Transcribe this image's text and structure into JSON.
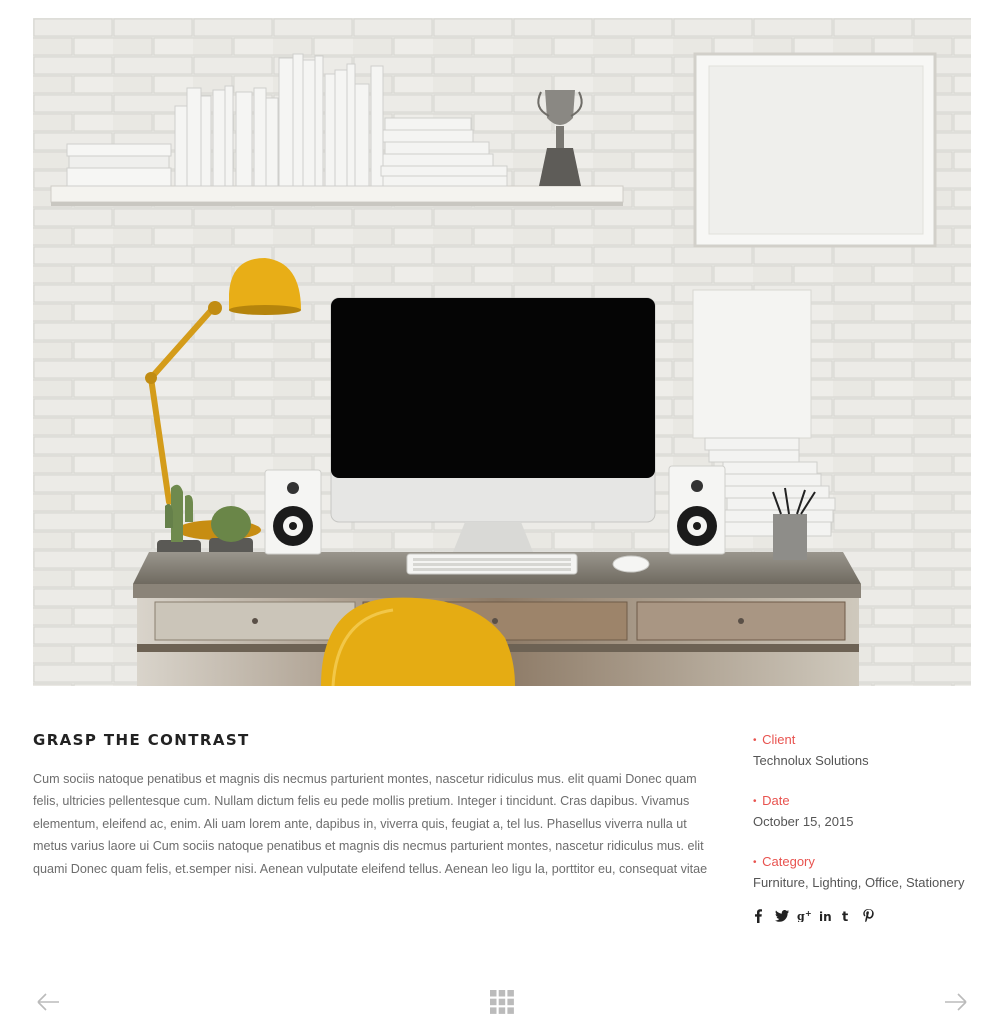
{
  "project": {
    "title": "GRASP THE CONTRAST",
    "description": "Cum sociis natoque penatibus et magnis dis necmus parturient montes, nascetur ridiculus mus. elit quami Donec quam felis, ultricies pellentesque cum. Nullam dictum felis eu pede mollis pretium. Integer i tincidunt. Cras dapibus. Vivamus elementum, eleifend ac, enim. Ali uam lorem ante, dapibus in, viverra quis, feugiat a, tel lus. Phasellus viverra nulla ut metus varius laore ui Cum sociis natoque penatibus et magnis dis necmus parturient montes, nascetur ridiculus mus. elit quami Donec quam felis, et.semper nisi. Aenean vulputate eleifend tellus. Aenean leo ligu la, porttitor eu, consequat vitae"
  },
  "meta": {
    "client_label": "Client",
    "client_value": "Technolux Solutions",
    "date_label": "Date",
    "date_value": "October 15, 2015",
    "category_label": "Category",
    "category_value": "Furniture, Lighting, Office, Stationery",
    "bullet": "•"
  },
  "social": {
    "facebook": "f",
    "twitter": "🐦",
    "googleplus": "g+",
    "linkedin": "in",
    "tumblr": "t",
    "pinterest": "p"
  },
  "colors": {
    "accent": "#e8534f",
    "heading": "#222222",
    "text": "#6d6d6d",
    "nav_icon": "#bbbbbb"
  },
  "icons": {
    "prev": "arrow-left-icon",
    "grid": "grid-icon",
    "next": "arrow-right-icon"
  }
}
